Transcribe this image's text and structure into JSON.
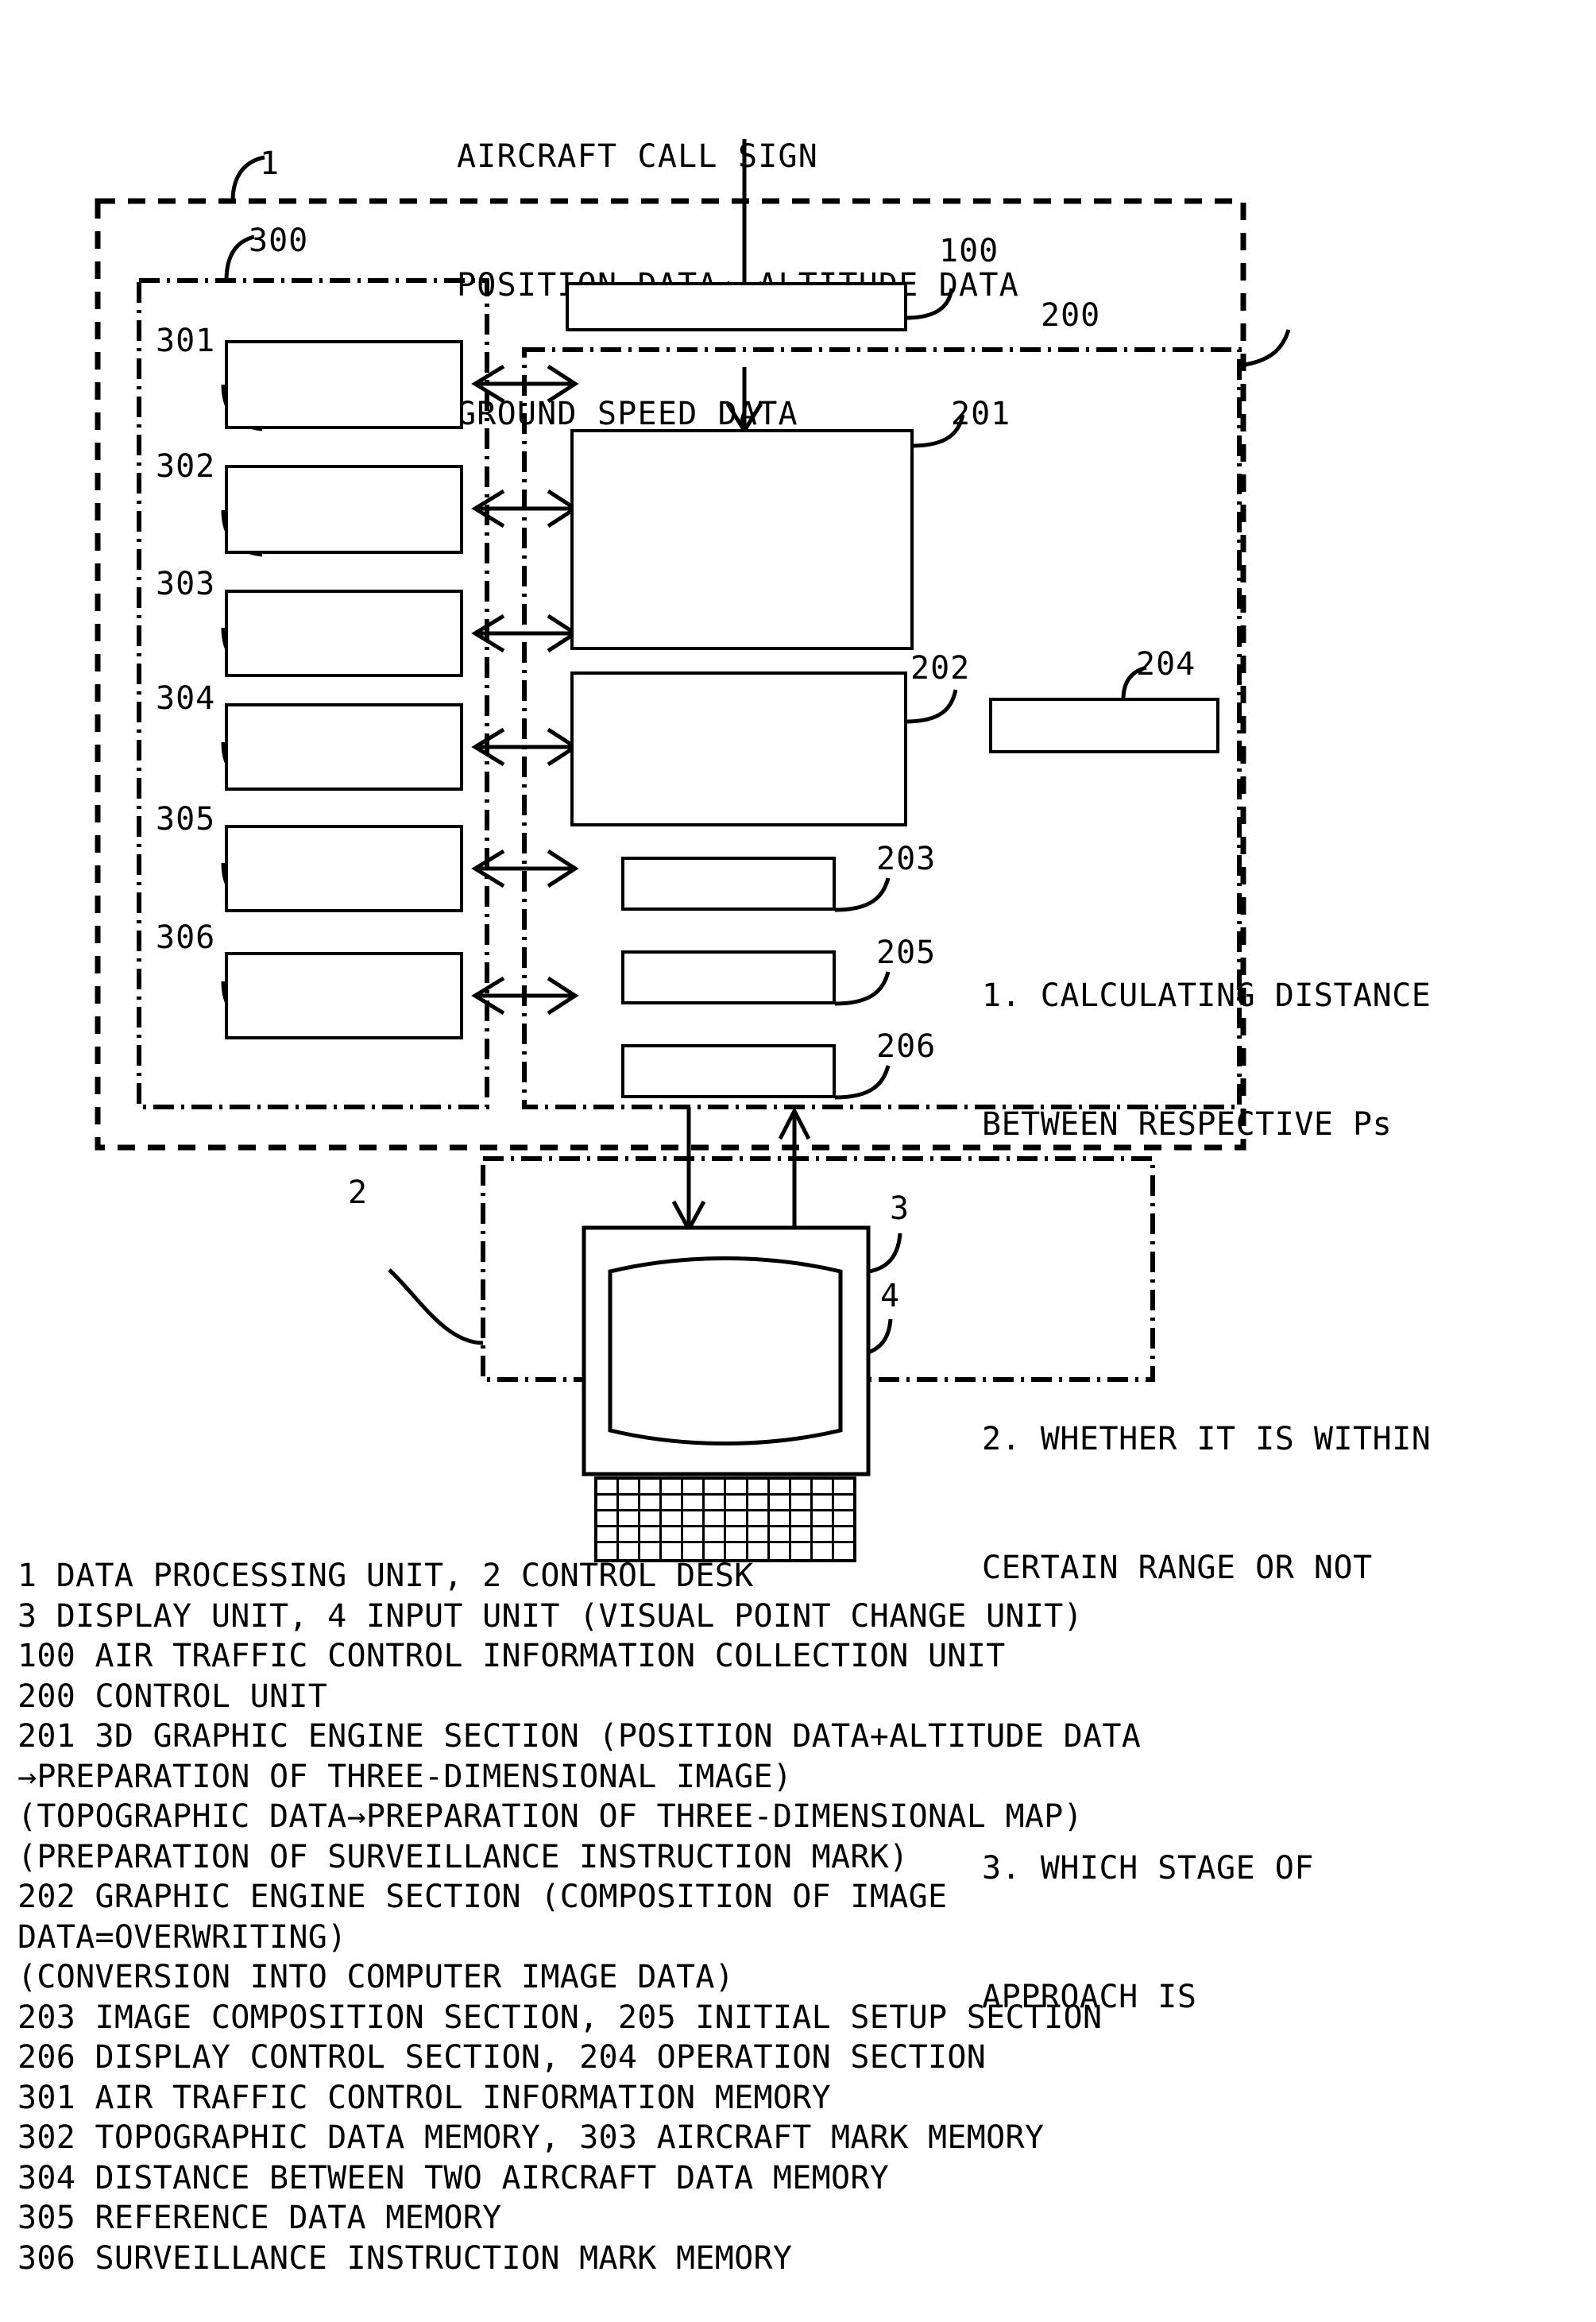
{
  "header": {
    "lines": [
      "AIRCRAFT CALL SIGN",
      "POSITION DATA, ALTITUDE DATA",
      "GROUND SPEED DATA"
    ]
  },
  "refs": {
    "unit_1": "1",
    "memory_group_300": "300",
    "collection_100": "100",
    "control_200": "200",
    "engine3d_201": "201",
    "graphic_202": "202",
    "composition_203": "203",
    "operation_204": "204",
    "initial_205": "205",
    "display_ctrl_206": "206",
    "mem_301": "301",
    "mem_302": "302",
    "mem_303": "303",
    "mem_304": "304",
    "mem_305": "305",
    "mem_306": "306",
    "desk_2": "2",
    "display_3": "3",
    "input_4": "4"
  },
  "calc_list": {
    "item1_line1": "1. CALCULATING DISTANCE",
    "item1_line2": "BETWEEN RESPECTIVE Ps",
    "item2_line1": "2. WHETHER IT IS WITHIN",
    "item2_line2": "CERTAIN RANGE OR NOT",
    "item3_line1": "3. WHICH STAGE OF",
    "item3_line2": "APPROACH IS"
  },
  "legend": {
    "lines": [
      "1 DATA PROCESSING UNIT, 2 CONTROL DESK",
      "3 DISPLAY UNIT, 4 INPUT UNIT (VISUAL POINT CHANGE UNIT)",
      "100 AIR TRAFFIC CONTROL INFORMATION COLLECTION UNIT",
      "200 CONTROL UNIT",
      "201 3D GRAPHIC ENGINE SECTION (POSITION DATA+ALTITUDE DATA",
      "→PREPARATION OF THREE-DIMENSIONAL IMAGE)",
      "(TOPOGRAPHIC DATA→PREPARATION OF THREE-DIMENSIONAL MAP)",
      "(PREPARATION OF SURVEILLANCE INSTRUCTION MARK)",
      "202 GRAPHIC ENGINE SECTION (COMPOSITION OF IMAGE",
      "DATA=OVERWRITING)",
      "(CONVERSION INTO COMPUTER IMAGE DATA)",
      "203 IMAGE COMPOSITION SECTION, 205 INITIAL SETUP SECTION",
      "206 DISPLAY CONTROL SECTION, 204 OPERATION SECTION",
      "301 AIR TRAFFIC CONTROL INFORMATION MEMORY",
      "302 TOPOGRAPHIC DATA MEMORY, 303 AIRCRAFT MARK MEMORY",
      "304 DISTANCE BETWEEN TWO AIRCRAFT DATA MEMORY",
      "305 REFERENCE DATA MEMORY",
      "306 SURVEILLANCE INSTRUCTION MARK MEMORY"
    ]
  },
  "colors": {
    "ink": "#000000",
    "paper": "#ffffff"
  },
  "keyboard": {
    "rows": 5,
    "cols": 12
  }
}
